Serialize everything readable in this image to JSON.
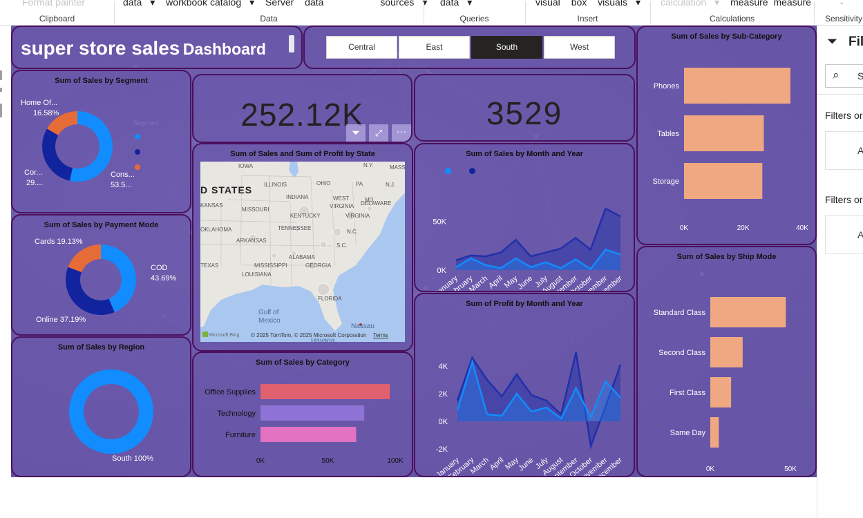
{
  "ribbon": {
    "groups": [
      {
        "name": "Clipboard",
        "items": [
          "Format painter"
        ]
      },
      {
        "name": "Data",
        "items": [
          "data",
          "workbook catalog",
          "Server",
          "data",
          "sources"
        ]
      },
      {
        "name": "Queries",
        "items": [
          "data"
        ]
      },
      {
        "name": "Insert",
        "items": [
          "visual",
          "box",
          "visuals"
        ]
      },
      {
        "name": "Calculations",
        "items": [
          "calculation",
          "measure",
          "measure"
        ]
      },
      {
        "name": "Sensitivity",
        "items": []
      }
    ]
  },
  "dashboard": {
    "title_part1": "super store sales",
    "title_part2": "Dashboard",
    "region_slicer": {
      "options": [
        "Central",
        "East",
        "South",
        "West"
      ],
      "selected": "South"
    },
    "kpi_sales": "252.12K",
    "kpi_count": "3529",
    "map": {
      "title": "Sum of Sales and Sum of Profit by State",
      "labels": [
        "IOWA",
        "N.Y.",
        "MASS",
        "ILLINOIS",
        "OHIO",
        "PA",
        "N.J.",
        "D STATES",
        "INDIANA",
        "MD",
        "DELAWARE",
        "KANSAS",
        "MISSOURI",
        "WEST",
        "VIRGINIA",
        "KENTUCKY",
        "VIRGINIA",
        "OKLAHOMA",
        "TENNESSEE",
        "N.C.",
        "ARKANSAS",
        "S.C.",
        "TEXAS",
        "MISSISSIPPI",
        "ALABAMA",
        "GEORGIA",
        "LOUISIANA",
        "FLORIDA",
        "Gulf of",
        "Mexico",
        "Nassau",
        "Havana"
      ],
      "attribution": "© 2025 TomTom, © 2025 Microsoft Corporation",
      "terms": "Terms",
      "provider": "Microsoft Bing"
    }
  },
  "chart_data": [
    {
      "type": "pie",
      "title": "Sum of Sales by Segment",
      "categories": [
        "Consumer",
        "Corporate",
        "Home Office"
      ],
      "values": [
        53.5,
        29.9,
        16.58
      ],
      "labels": [
        "Cons...",
        "53.5...",
        "Cor...",
        "29....",
        "Home Of...",
        "16.58%"
      ],
      "colors": [
        "#118dff",
        "#12239e",
        "#e66c37"
      ],
      "legend_title": "Segment"
    },
    {
      "type": "pie",
      "title": "Sum of Sales by Payment Mode",
      "categories": [
        "COD",
        "Online",
        "Cards"
      ],
      "values": [
        43.69,
        37.19,
        19.13
      ],
      "labels": [
        "COD",
        "43.69%",
        "Online 37.19%",
        "Cards 19.13%"
      ],
      "colors": [
        "#118dff",
        "#12239e",
        "#e66c37"
      ]
    },
    {
      "type": "pie",
      "title": "Sum of Sales by Region",
      "categories": [
        "South"
      ],
      "values": [
        100
      ],
      "labels": [
        "South 100%"
      ],
      "colors": [
        "#118dff"
      ]
    },
    {
      "type": "bar",
      "title": "Sum of Sales by Category",
      "categories": [
        "Office Supplies",
        "Technology",
        "Furniture"
      ],
      "values": [
        96000,
        77000,
        71000
      ],
      "colors": [
        "#e06070",
        "#8f72d6",
        "#e272c2"
      ],
      "xticks": [
        "0K",
        "50K",
        "100K"
      ],
      "xlim": [
        0,
        100000
      ]
    },
    {
      "type": "area",
      "title": "Sum of Sales by Month and Year",
      "categories": [
        "January",
        "February",
        "March",
        "April",
        "May",
        "June",
        "July",
        "August",
        "September",
        "October",
        "November",
        "December"
      ],
      "series": [
        {
          "values": [
            10000,
            15000,
            14000,
            18000,
            31000,
            14000,
            18000,
            22000,
            33000,
            21000,
            63000,
            55000
          ],
          "color": "#2030a8"
        },
        {
          "values": [
            3000,
            12000,
            5000,
            2000,
            12000,
            3000,
            8000,
            2000,
            11000,
            1000,
            21000,
            16000
          ],
          "color": "#118dff"
        }
      ],
      "yticks": [
        "0K",
        "50K"
      ],
      "ylim": [
        0,
        80000
      ]
    },
    {
      "type": "area",
      "title": "Sum of Profit by Month and Year",
      "categories": [
        "January",
        "February",
        "March",
        "April",
        "May",
        "June",
        "July",
        "August",
        "September",
        "October",
        "November",
        "December"
      ],
      "series": [
        {
          "values": [
            1500,
            4600,
            3000,
            1800,
            3400,
            1900,
            1500,
            500,
            5000,
            -1800,
            1100,
            4100
          ],
          "color": "#2030a8"
        },
        {
          "values": [
            800,
            4300,
            500,
            400,
            2000,
            700,
            1000,
            200,
            2400,
            300,
            2900,
            1700
          ],
          "color": "#118dff"
        }
      ],
      "yticks": [
        "-2K",
        "0K",
        "2K",
        "4K"
      ],
      "ylim": [
        -2500,
        5000
      ]
    },
    {
      "type": "bar",
      "title": "Sum of Sales by Sub-Category",
      "categories": [
        "Phones",
        "Tables",
        "Storage"
      ],
      "values": [
        36000,
        27000,
        26500
      ],
      "colors": [
        "#f0a882",
        "#f0a882",
        "#f0a882"
      ],
      "xticks": [
        "0K",
        "20K",
        "40K"
      ],
      "xlim": [
        0,
        40000
      ]
    },
    {
      "type": "bar",
      "title": "Sum of Sales by Ship Mode",
      "categories": [
        "Standard Class",
        "Second Class",
        "First Class",
        "Same Day"
      ],
      "values": [
        49000,
        21000,
        13500,
        5500
      ],
      "colors": [
        "#f0a882",
        "#f0a882",
        "#f0a882",
        "#f0a882"
      ],
      "xticks": [
        "0K",
        "50K"
      ],
      "xlim": [
        0,
        52000
      ]
    }
  ],
  "filters_pane": {
    "title": "Fil",
    "search_placeholder": "S",
    "filters_on_page": "Filters or",
    "filters_on_all": "Filters or",
    "add_label": "A"
  }
}
